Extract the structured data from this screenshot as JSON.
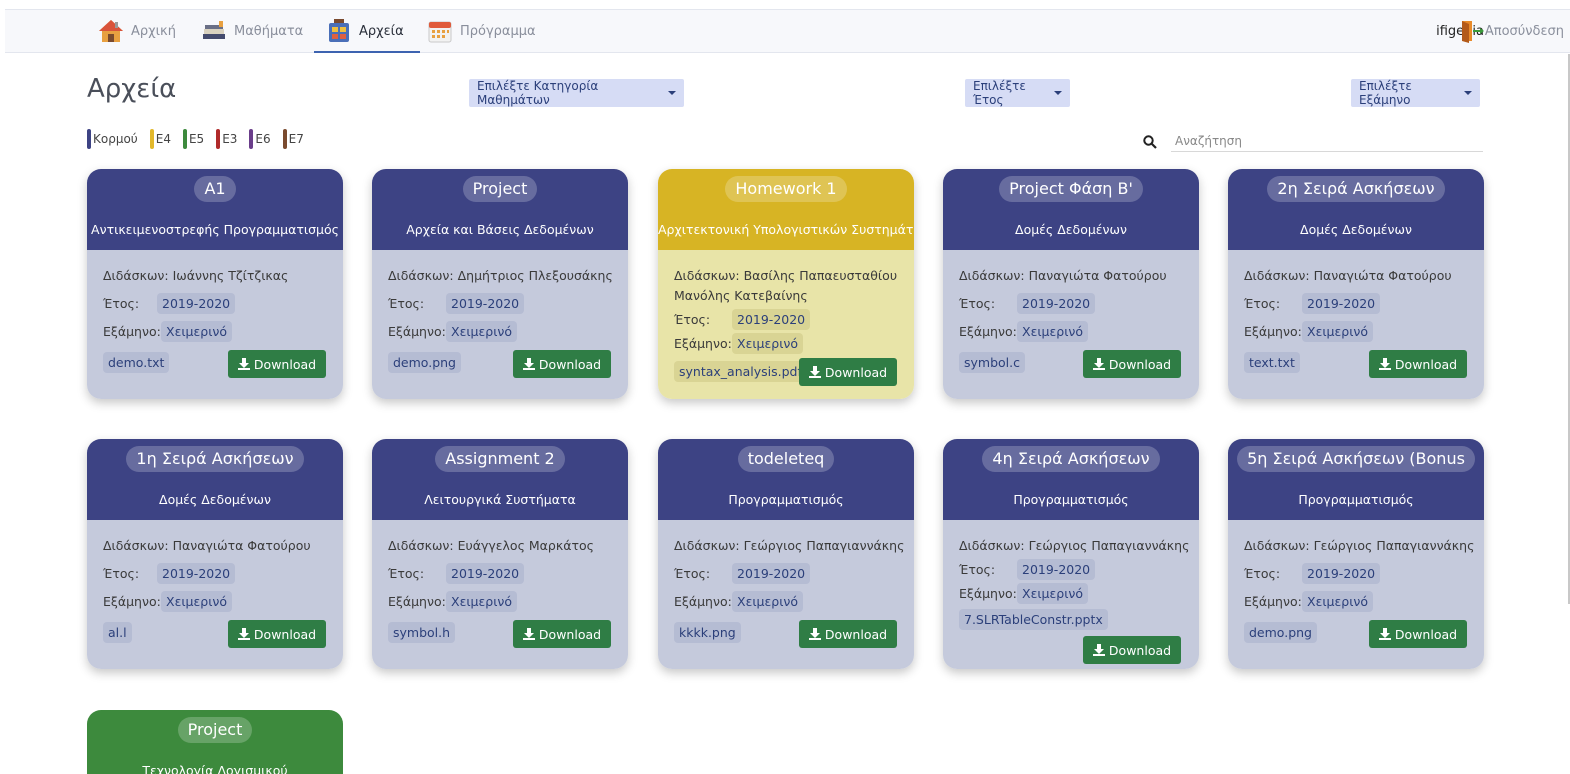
{
  "nav": {
    "items": [
      {
        "label": "Αρχική",
        "icon": "home-icon"
      },
      {
        "label": "Μαθήματα",
        "icon": "books-icon"
      },
      {
        "label": "Αρχεία",
        "icon": "archive-icon"
      },
      {
        "label": "Πρόγραμμα",
        "icon": "calendar-icon"
      }
    ],
    "active": "Αρχεία",
    "username": "ifigenia",
    "logout": "Αποσύνδεση"
  },
  "page": {
    "title": "Αρχεία",
    "category_dropdown": "Επιλέξτε Κατηγορία Μαθημάτων",
    "year_dropdown": "Επιλέξτε Έτος",
    "semester_dropdown": "Επιλέξτε Εξάμηνο",
    "search_placeholder": "Αναζήτηση"
  },
  "legend": [
    {
      "label": "Κορμού",
      "color": "#3d4384"
    },
    {
      "label": "Ε4",
      "color": "#e2b82b"
    },
    {
      "label": "Ε5",
      "color": "#3d8a3d"
    },
    {
      "label": "Ε3",
      "color": "#b02a2a"
    },
    {
      "label": "Ε6",
      "color": "#6a3d8a"
    },
    {
      "label": "Ε7",
      "color": "#7a4a2e"
    }
  ],
  "labels": {
    "teacher": "Διδάσκων:",
    "year": "Έτος:",
    "semester": "Εξάμηνο:",
    "download": "Download"
  },
  "cards": [
    {
      "title": "Α1",
      "course": "Αντικειμενοστρεφής Προγραμματισμός",
      "teacher": "Ιωάννης Τζίτζικας",
      "year": "2019-2020",
      "semester": "Χειμερινό",
      "file": "demo.txt"
    },
    {
      "title": "Project",
      "course": "Αρχεία και Βάσεις Δεδομένων",
      "teacher": "Δημήτριος Πλεξουσάκης",
      "year": "2019-2020",
      "semester": "Χειμερινό",
      "file": "demo.png"
    },
    {
      "title": "Homework 1",
      "course": "Αρχιτεκτονική Υπολογιστικών Συστημάτων",
      "teacher": "Βασίλης Παπαευσταθίου",
      "teacher2": "Μανόλης Κατεβαίνης",
      "year": "2019-2020",
      "semester": "Χειμερινό",
      "file": "syntax_analysis.pdf"
    },
    {
      "title": "Project Φάση Β'",
      "course": "Δομές Δεδομένων",
      "teacher": "Παναγιώτα Φατούρου",
      "year": "2019-2020",
      "semester": "Χειμερινό",
      "file": "symbol.c"
    },
    {
      "title": "2η Σειρά Ασκήσεων",
      "course": "Δομές Δεδομένων",
      "teacher": "Παναγιώτα Φατούρου",
      "year": "2019-2020",
      "semester": "Χειμερινό",
      "file": "text.txt"
    },
    {
      "title": "1η Σειρά Ασκήσεων",
      "course": "Δομές Δεδομένων",
      "teacher": "Παναγιώτα Φατούρου",
      "year": "2019-2020",
      "semester": "Χειμερινό",
      "file": "al.l"
    },
    {
      "title": "Assignment 2",
      "course": "Λειτουργικά Συστήματα",
      "teacher": "Ευάγγελος Μαρκάτος",
      "year": "2019-2020",
      "semester": "Χειμερινό",
      "file": "symbol.h"
    },
    {
      "title": "todeleteq",
      "course": "Προγραμματισμός",
      "teacher": "Γεώργιος Παπαγιαννάκης",
      "year": "2019-2020",
      "semester": "Χειμερινό",
      "file": "kkkk.png"
    },
    {
      "title": "4η Σειρά Ασκήσεων",
      "course": "Προγραμματισμός",
      "teacher": "Γεώργιος Παπαγιαννάκης",
      "year": "2019-2020",
      "semester": "Χειμερινό",
      "file": "7.SLRTableConstr.pptx"
    },
    {
      "title": "5η Σειρά Ασκήσεων (Bonus",
      "course": "Προγραμματισμός",
      "teacher": "Γεώργιος Παπαγιαννάκης",
      "year": "2019-2020",
      "semester": "Χειμερινό",
      "file": "demo.png"
    },
    {
      "title": "Project",
      "course": "Τεχνολογία Λογισμικού"
    }
  ]
}
